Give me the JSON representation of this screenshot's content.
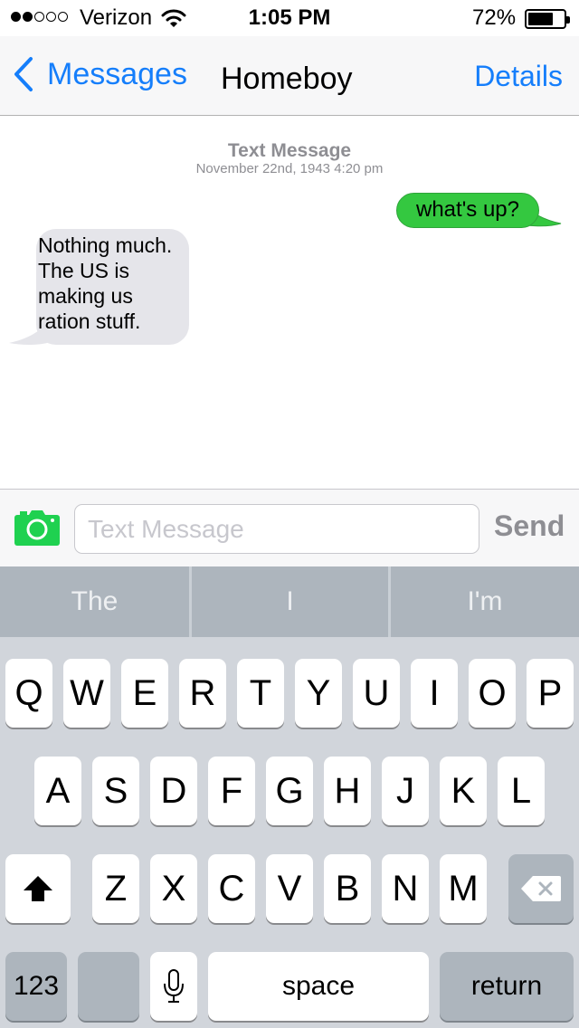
{
  "status_bar": {
    "carrier": "Verizon",
    "time": "1:05 PM",
    "battery_percent_label": "72%",
    "battery_level": 0.72,
    "signal_bars": 2,
    "signal_total": 5
  },
  "nav": {
    "back_label": "Messages",
    "title": "Homeboy",
    "details_label": "Details"
  },
  "conversation": {
    "kind_label": "Text Message",
    "date_label": "November 22nd, 1943 4:20 pm",
    "messages": [
      {
        "direction": "outgoing",
        "text": "what's up?"
      },
      {
        "direction": "incoming",
        "lines": [
          "Nothing much.",
          "The US is",
          "making us",
          "ration stuff."
        ]
      }
    ]
  },
  "composer": {
    "placeholder": "Text Message",
    "send_label": "Send",
    "camera_icon": "camera-icon"
  },
  "keyboard": {
    "suggestions": [
      "The",
      "I",
      "I'm"
    ],
    "row1": [
      "Q",
      "W",
      "E",
      "R",
      "T",
      "Y",
      "U",
      "I",
      "O",
      "P"
    ],
    "row2": [
      "A",
      "S",
      "D",
      "F",
      "G",
      "H",
      "J",
      "K",
      "L"
    ],
    "row3": [
      "Z",
      "X",
      "C",
      "V",
      "B",
      "N",
      "M"
    ],
    "numbers_label": "123",
    "space_label": "space",
    "return_label": "return",
    "shift_icon": "shift-icon",
    "delete_icon": "delete-icon",
    "mic_icon": "microphone-icon"
  },
  "colors": {
    "accent": "#157efb",
    "outgoing_bubble": "#34c840",
    "incoming_bubble": "#e5e5ea",
    "camera": "#1fd150"
  }
}
